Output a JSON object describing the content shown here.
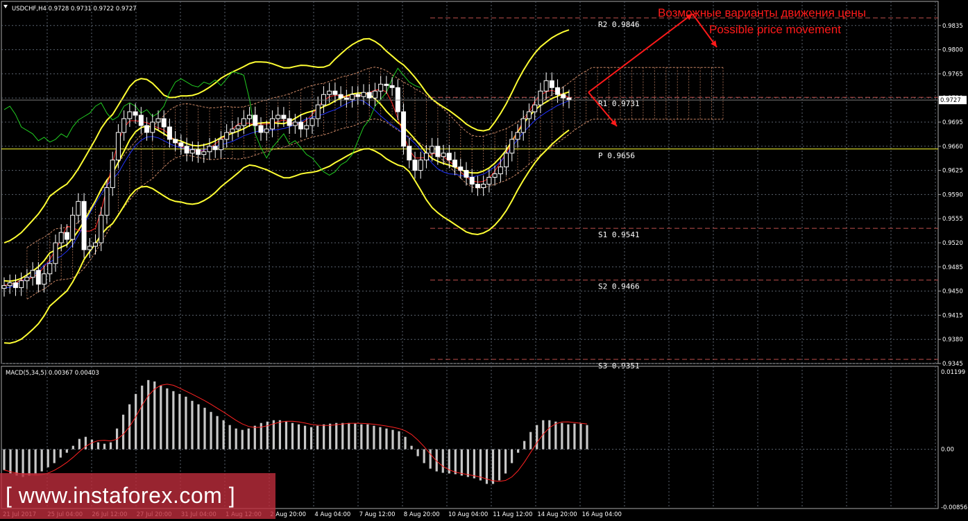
{
  "header": {
    "title": "USDCHF,H4  0.9728 0.9731 0.9722 0.9727"
  },
  "macd_header": {
    "title": "MACD(5,34,5) 0.00367 0.00403"
  },
  "current_price": "0.9727",
  "annotation": {
    "ru": "Возможные варианты движения цены",
    "en": "Possible price movement"
  },
  "watermark": "[ www.instaforex.com ]",
  "colors": {
    "background": "#000000",
    "grid": "#5b6470",
    "bollinger": "#ffff33",
    "tenkan": "#ff2222",
    "kijun": "#2233ff",
    "chikou": "#22cc22",
    "cloud": "#cc8866",
    "pivot_line": "#c0504d",
    "pivot_p": "#ffff33",
    "arrows": "#ff1a1a",
    "macd_hist": "#c8c8c8",
    "macd_signal": "#ff2222"
  },
  "pivot_levels": [
    {
      "label": "R2  0.9846",
      "value": 0.9846
    },
    {
      "label": "R1  0.9731",
      "value": 0.9731
    },
    {
      "label": "P  0.9656",
      "value": 0.9656
    },
    {
      "label": "S1  0.9541",
      "value": 0.9541
    },
    {
      "label": "S2  0.9466",
      "value": 0.9466
    },
    {
      "label": "S3  0.9351",
      "value": 0.9351
    }
  ],
  "chart_data": [
    {
      "type": "candlestick",
      "title": "USDCHF,H4",
      "ylim": [
        0.9345,
        0.987
      ],
      "y_ticks": [
        "0.9835",
        "0.9800",
        "0.9765",
        "0.9730",
        "0.9695",
        "0.9660",
        "0.9625",
        "0.9590",
        "0.9555",
        "0.9520",
        "0.9485",
        "0.9450",
        "0.9415",
        "0.9380",
        "0.9345"
      ],
      "x_ticks": [
        "21 Jul 2017",
        "25 Jul 04:00",
        "26 Jul 12:00",
        "27 Jul 20:00",
        "31 Jul 04:00",
        "1 Aug 12:00",
        "2 Aug 20:00",
        "4 Aug 04:00",
        "7 Aug 12:00",
        "8 Aug 20:00",
        "10 Aug 04:00",
        "11 Aug 12:00",
        "14 Aug 20:00",
        "16 Aug 04:00"
      ],
      "grid": true,
      "series": [
        {
          "name": "Close",
          "values": [
            0.9458,
            0.9462,
            0.9455,
            0.9465,
            0.947,
            0.948,
            0.946,
            0.9475,
            0.949,
            0.952,
            0.9535,
            0.9525,
            0.956,
            0.958,
            0.951,
            0.9515,
            0.952,
            0.956,
            0.96,
            0.964,
            0.968,
            0.97,
            0.971,
            0.9705,
            0.969,
            0.968,
            0.9695,
            0.97,
            0.9688,
            0.967,
            0.9665,
            0.966,
            0.965,
            0.9655,
            0.9648,
            0.9652,
            0.966,
            0.9655,
            0.967,
            0.968,
            0.9685,
            0.969,
            0.97,
            0.9705,
            0.969,
            0.968,
            0.9685,
            0.97,
            0.9705,
            0.97,
            0.969,
            0.9695,
            0.9685,
            0.969,
            0.97,
            0.972,
            0.9735,
            0.974,
            0.9735,
            0.973,
            0.9728,
            0.9735,
            0.9732,
            0.9738,
            0.973,
            0.974,
            0.975,
            0.9748,
            0.9745,
            0.971,
            0.966,
            0.964,
            0.9625,
            0.964,
            0.965,
            0.966,
            0.9645,
            0.965,
            0.964,
            0.963,
            0.9625,
            0.9615,
            0.9605,
            0.96,
            0.9605,
            0.9615,
            0.962,
            0.963,
            0.965,
            0.967,
            0.968,
            0.97,
            0.971,
            0.972,
            0.974,
            0.9755,
            0.9745,
            0.9735,
            0.973,
            0.9727
          ]
        },
        {
          "name": "Bollinger Upper"
        },
        {
          "name": "Bollinger Lower"
        },
        {
          "name": "Tenkan-sen"
        },
        {
          "name": "Kijun-sen"
        },
        {
          "name": "Chikou Span"
        }
      ]
    },
    {
      "type": "bar",
      "title": "MACD(5,34,5)",
      "ylim": [
        -0.00856,
        0.01199
      ],
      "y_ticks": [
        "0.01199",
        "0.00",
        "-0.00856"
      ],
      "series": [
        {
          "name": "MACD",
          "values": [
            -0.003,
            -0.0035,
            -0.0038,
            -0.004,
            -0.0038,
            -0.0036,
            -0.0032,
            -0.0026,
            -0.002,
            -0.0012,
            -0.0005,
            0.0005,
            0.0015,
            0.0018,
            0.0014,
            0.001,
            0.0008,
            0.001,
            0.003,
            0.005,
            0.0065,
            0.008,
            0.0092,
            0.01,
            0.0098,
            0.0092,
            0.0088,
            0.0084,
            0.008,
            0.0076,
            0.007,
            0.0065,
            0.006,
            0.0054,
            0.0048,
            0.0042,
            0.0035,
            0.003,
            0.0028,
            0.003,
            0.0034,
            0.0038,
            0.004,
            0.0042,
            0.0042,
            0.004,
            0.0038,
            0.0036,
            0.0034,
            0.0032,
            0.0034,
            0.0036,
            0.0037,
            0.0038,
            0.0038,
            0.0038,
            0.0037,
            0.0036,
            0.0036,
            0.0034,
            0.0032,
            0.003,
            0.0028,
            0.0026,
            0.0018,
            0.0005,
            -0.001,
            -0.002,
            -0.0028,
            -0.0032,
            -0.0034,
            -0.0035,
            -0.0036,
            -0.0038,
            -0.004,
            -0.0042,
            -0.0045,
            -0.005,
            -0.005,
            -0.0045,
            -0.0035,
            -0.002,
            -0.0005,
            0.0012,
            0.0025,
            0.0035,
            0.0042,
            0.0042,
            0.004,
            0.0038,
            0.0036,
            0.0037,
            0.0037,
            0.0035
          ]
        },
        {
          "name": "Signal"
        }
      ]
    }
  ]
}
